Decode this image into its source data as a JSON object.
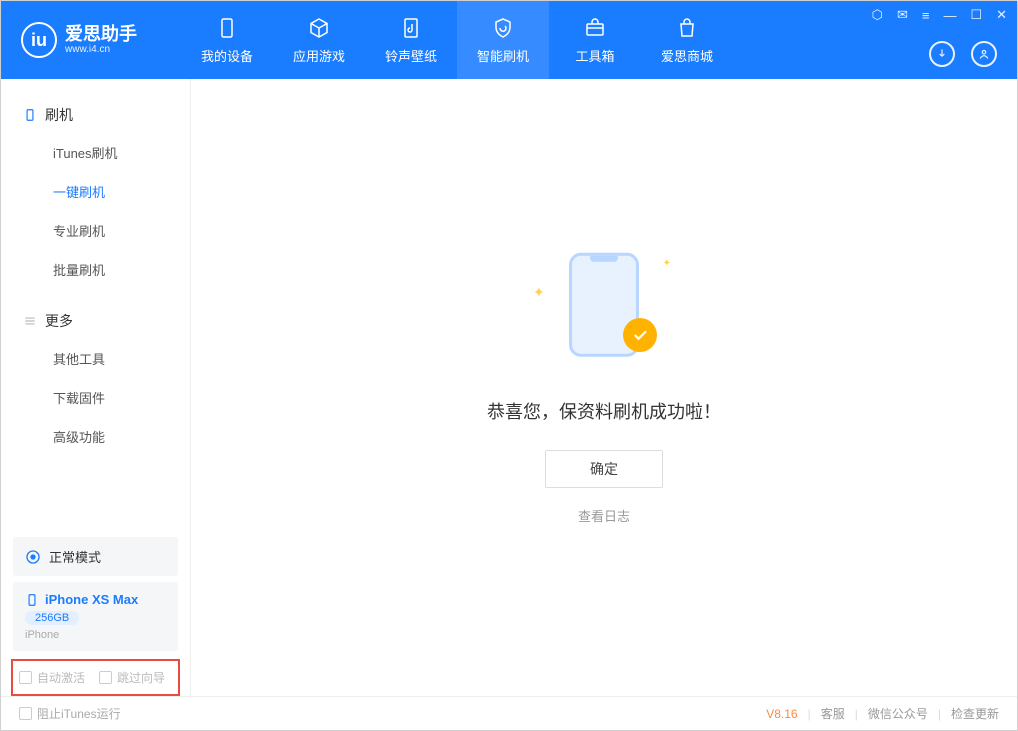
{
  "app": {
    "name": "爱思助手",
    "url": "www.i4.cn"
  },
  "nav": {
    "tabs": [
      {
        "label": "我的设备"
      },
      {
        "label": "应用游戏"
      },
      {
        "label": "铃声壁纸"
      },
      {
        "label": "智能刷机"
      },
      {
        "label": "工具箱"
      },
      {
        "label": "爱思商城"
      }
    ],
    "active_index": 3
  },
  "sidebar": {
    "sections": [
      {
        "title": "刷机",
        "items": [
          "iTunes刷机",
          "一键刷机",
          "专业刷机",
          "批量刷机"
        ],
        "active_index": 1
      },
      {
        "title": "更多",
        "items": [
          "其他工具",
          "下载固件",
          "高级功能"
        ],
        "active_index": -1
      }
    ],
    "normal_mode": "正常模式",
    "device": {
      "name": "iPhone XS Max",
      "capacity": "256GB",
      "type": "iPhone"
    },
    "options": {
      "auto_activate": "自动激活",
      "skip_guide": "跳过向导"
    }
  },
  "main": {
    "success_text": "恭喜您，保资料刷机成功啦！",
    "ok_button": "确定",
    "view_log": "查看日志"
  },
  "footer": {
    "stop_itunes": "阻止iTunes运行",
    "version": "V8.16",
    "links": [
      "客服",
      "微信公众号",
      "检查更新"
    ]
  },
  "colors": {
    "primary": "#1a7cff",
    "accent": "#ffb300",
    "highlight_border": "#e74c3c"
  }
}
